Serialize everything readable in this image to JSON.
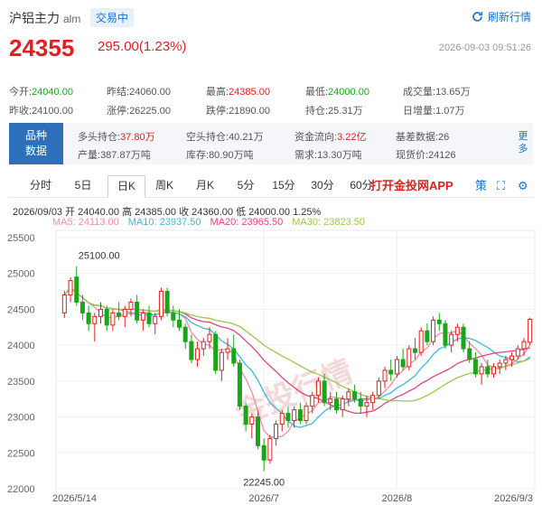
{
  "header": {
    "title": "沪铝主力",
    "code": "alm",
    "status": "交易中",
    "refresh_label": "刷新行情",
    "price": "24355",
    "change": "295.00(1.23%)",
    "timestamp": "2026-09-03 09:51:26"
  },
  "stats_row1": [
    {
      "label": "今开:",
      "value": "24040.00",
      "color": "green"
    },
    {
      "label": "昨结:",
      "value": "24060.00",
      "color": "normal"
    },
    {
      "label": "最高:",
      "value": "24385.00",
      "color": "red"
    },
    {
      "label": "最低:",
      "value": "24000.00",
      "color": "green"
    },
    {
      "label": "成交量:",
      "value": "13.65万",
      "color": "normal"
    }
  ],
  "stats_row2": [
    {
      "label": "昨收:",
      "value": "24100.00",
      "color": "normal"
    },
    {
      "label": "涨停:",
      "value": "26225.00",
      "color": "normal"
    },
    {
      "label": "跌停:",
      "value": "21890.00",
      "color": "normal"
    },
    {
      "label": "持仓:",
      "value": "25.31万",
      "color": "normal"
    },
    {
      "label": "日增量:",
      "value": "1.07万",
      "color": "normal"
    }
  ],
  "variety": {
    "tag_line1": "品种",
    "tag_line2": "数据",
    "row1": [
      {
        "label": "多头持仓:",
        "value": "37.80万",
        "color": "red"
      },
      {
        "label": "空头持仓:",
        "value": "40.21万",
        "color": "normal"
      },
      {
        "label": "资金流向:",
        "value": "3.22亿",
        "color": "red"
      },
      {
        "label": "基差数据:",
        "value": "26",
        "color": "normal"
      }
    ],
    "row2": [
      {
        "label": "产量:",
        "value": "387.87万吨",
        "color": "normal"
      },
      {
        "label": "库存:",
        "value": "80.90万吨",
        "color": "normal"
      },
      {
        "label": "需求:",
        "value": "13.30万吨",
        "color": "normal"
      },
      {
        "label": "现货价:",
        "value": "24126",
        "color": "normal"
      }
    ],
    "more_line1": "更",
    "more_line2": "多"
  },
  "tabs": [
    "分时",
    "5日",
    "日K",
    "周K",
    "月K",
    "5分",
    "15分",
    "30分",
    "60分"
  ],
  "active_tab": "日K",
  "app_link": "打开金投网APP",
  "tools": {
    "draw": "策",
    "fullscreen": "⛶",
    "settings": "⚙"
  },
  "ohlc_line": "2026/09/03  开 24040.00  高 24385.00  收 24360.00  低 24000.00  1.25%",
  "ma_legend": [
    {
      "label": "MA5: 24113.00",
      "color": "#f08ca8"
    },
    {
      "label": "MA10: 23937.50",
      "color": "#3fb8d8"
    },
    {
      "label": "MA20: 23965.50",
      "color": "#e0457b"
    },
    {
      "label": "MA30: 23823.50",
      "color": "#9cc84a"
    }
  ],
  "watermark": "金投行情",
  "chart_data": {
    "type": "candlestick",
    "x_ticks": [
      "2026/5/14",
      "2026/7",
      "2026/8",
      "2026/9/3"
    ],
    "x_tick_index": [
      0,
      33,
      55,
      77
    ],
    "ylim": [
      22000,
      25600
    ],
    "y_ticks": [
      25500,
      25000,
      24500,
      24000,
      23500,
      23000,
      22500,
      22000
    ],
    "annotations": [
      {
        "text": "25100.00",
        "index": 2,
        "value": 25100
      },
      {
        "text": "22245.00",
        "index": 33,
        "value": 22245
      }
    ],
    "candles": [
      {
        "o": 24450,
        "h": 24760,
        "l": 24380,
        "c": 24700
      },
      {
        "o": 24700,
        "h": 24950,
        "l": 24600,
        "c": 24900
      },
      {
        "o": 24950,
        "h": 25100,
        "l": 24550,
        "c": 24600
      },
      {
        "o": 24600,
        "h": 24700,
        "l": 24350,
        "c": 24450
      },
      {
        "o": 24450,
        "h": 24550,
        "l": 24200,
        "c": 24300
      },
      {
        "o": 24300,
        "h": 24450,
        "l": 24050,
        "c": 24400
      },
      {
        "o": 24400,
        "h": 24600,
        "l": 24300,
        "c": 24500
      },
      {
        "o": 24500,
        "h": 24550,
        "l": 24200,
        "c": 24280
      },
      {
        "o": 24280,
        "h": 24500,
        "l": 24200,
        "c": 24450
      },
      {
        "o": 24450,
        "h": 24600,
        "l": 24350,
        "c": 24400
      },
      {
        "o": 24400,
        "h": 24550,
        "l": 24250,
        "c": 24500
      },
      {
        "o": 24500,
        "h": 24650,
        "l": 24400,
        "c": 24600
      },
      {
        "o": 24600,
        "h": 24700,
        "l": 24300,
        "c": 24350
      },
      {
        "o": 24350,
        "h": 24500,
        "l": 24200,
        "c": 24450
      },
      {
        "o": 24450,
        "h": 24550,
        "l": 24250,
        "c": 24300
      },
      {
        "o": 24300,
        "h": 24450,
        "l": 24150,
        "c": 24400
      },
      {
        "o": 24400,
        "h": 24800,
        "l": 24350,
        "c": 24750
      },
      {
        "o": 24750,
        "h": 24800,
        "l": 24400,
        "c": 24450
      },
      {
        "o": 24450,
        "h": 24550,
        "l": 24250,
        "c": 24350
      },
      {
        "o": 24350,
        "h": 24500,
        "l": 24200,
        "c": 24250
      },
      {
        "o": 24250,
        "h": 24300,
        "l": 23950,
        "c": 24050
      },
      {
        "o": 24050,
        "h": 24150,
        "l": 23750,
        "c": 23800
      },
      {
        "o": 23800,
        "h": 24050,
        "l": 23700,
        "c": 23950
      },
      {
        "o": 23950,
        "h": 24100,
        "l": 23850,
        "c": 24050
      },
      {
        "o": 24050,
        "h": 24250,
        "l": 23950,
        "c": 24150
      },
      {
        "o": 24150,
        "h": 24200,
        "l": 23600,
        "c": 23650
      },
      {
        "o": 23650,
        "h": 23950,
        "l": 23500,
        "c": 23900
      },
      {
        "o": 23900,
        "h": 24100,
        "l": 23800,
        "c": 23950
      },
      {
        "o": 23950,
        "h": 24150,
        "l": 23700,
        "c": 23750
      },
      {
        "o": 23750,
        "h": 23800,
        "l": 23100,
        "c": 23150
      },
      {
        "o": 23150,
        "h": 23200,
        "l": 22800,
        "c": 22900
      },
      {
        "o": 22900,
        "h": 23050,
        "l": 22700,
        "c": 23000
      },
      {
        "o": 23000,
        "h": 23100,
        "l": 22550,
        "c": 22600
      },
      {
        "o": 22600,
        "h": 22700,
        "l": 22245,
        "c": 22400
      },
      {
        "o": 22400,
        "h": 22750,
        "l": 22350,
        "c": 22700
      },
      {
        "o": 22700,
        "h": 22950,
        "l": 22600,
        "c": 22900
      },
      {
        "o": 22900,
        "h": 23100,
        "l": 22800,
        "c": 23050
      },
      {
        "o": 23050,
        "h": 23150,
        "l": 22850,
        "c": 22950
      },
      {
        "o": 22950,
        "h": 23150,
        "l": 22850,
        "c": 23100
      },
      {
        "o": 23100,
        "h": 23200,
        "l": 22900,
        "c": 22950
      },
      {
        "o": 22950,
        "h": 23200,
        "l": 22900,
        "c": 23150
      },
      {
        "o": 23150,
        "h": 23350,
        "l": 23050,
        "c": 23300
      },
      {
        "o": 23300,
        "h": 23550,
        "l": 23200,
        "c": 23500
      },
      {
        "o": 23500,
        "h": 23600,
        "l": 23150,
        "c": 23200
      },
      {
        "o": 23200,
        "h": 23350,
        "l": 23100,
        "c": 23250
      },
      {
        "o": 23250,
        "h": 23350,
        "l": 23050,
        "c": 23100
      },
      {
        "o": 23100,
        "h": 23300,
        "l": 23000,
        "c": 23250
      },
      {
        "o": 23250,
        "h": 23400,
        "l": 23150,
        "c": 23350
      },
      {
        "o": 23350,
        "h": 23450,
        "l": 23200,
        "c": 23250
      },
      {
        "o": 23250,
        "h": 23350,
        "l": 23050,
        "c": 23150
      },
      {
        "o": 23150,
        "h": 23300,
        "l": 23000,
        "c": 23200
      },
      {
        "o": 23200,
        "h": 23350,
        "l": 23100,
        "c": 23300
      },
      {
        "o": 23300,
        "h": 23550,
        "l": 23250,
        "c": 23500
      },
      {
        "o": 23500,
        "h": 23700,
        "l": 23400,
        "c": 23650
      },
      {
        "o": 23650,
        "h": 23800,
        "l": 23500,
        "c": 23600
      },
      {
        "o": 23600,
        "h": 23850,
        "l": 23550,
        "c": 23800
      },
      {
        "o": 23800,
        "h": 23950,
        "l": 23650,
        "c": 23700
      },
      {
        "o": 23700,
        "h": 24000,
        "l": 23650,
        "c": 23950
      },
      {
        "o": 23950,
        "h": 24100,
        "l": 23800,
        "c": 23900
      },
      {
        "o": 23900,
        "h": 24250,
        "l": 23850,
        "c": 24200
      },
      {
        "o": 24200,
        "h": 24300,
        "l": 24000,
        "c": 24050
      },
      {
        "o": 24050,
        "h": 24400,
        "l": 24000,
        "c": 24350
      },
      {
        "o": 24350,
        "h": 24450,
        "l": 24200,
        "c": 24300
      },
      {
        "o": 24300,
        "h": 24350,
        "l": 23950,
        "c": 24000
      },
      {
        "o": 24000,
        "h": 24200,
        "l": 23900,
        "c": 24150
      },
      {
        "o": 24150,
        "h": 24300,
        "l": 24050,
        "c": 24250
      },
      {
        "o": 24250,
        "h": 24300,
        "l": 23900,
        "c": 23950
      },
      {
        "o": 23950,
        "h": 24050,
        "l": 23750,
        "c": 23800
      },
      {
        "o": 23800,
        "h": 23900,
        "l": 23550,
        "c": 23600
      },
      {
        "o": 23600,
        "h": 23750,
        "l": 23450,
        "c": 23700
      },
      {
        "o": 23700,
        "h": 23800,
        "l": 23550,
        "c": 23600
      },
      {
        "o": 23600,
        "h": 23750,
        "l": 23550,
        "c": 23700
      },
      {
        "o": 23700,
        "h": 23800,
        "l": 23600,
        "c": 23750
      },
      {
        "o": 23750,
        "h": 23850,
        "l": 23650,
        "c": 23800
      },
      {
        "o": 23800,
        "h": 23900,
        "l": 23700,
        "c": 23850
      },
      {
        "o": 23850,
        "h": 24000,
        "l": 23800,
        "c": 23950
      },
      {
        "o": 23950,
        "h": 24100,
        "l": 23850,
        "c": 24050
      },
      {
        "o": 24040,
        "h": 24385,
        "l": 24000,
        "c": 24360
      }
    ]
  }
}
